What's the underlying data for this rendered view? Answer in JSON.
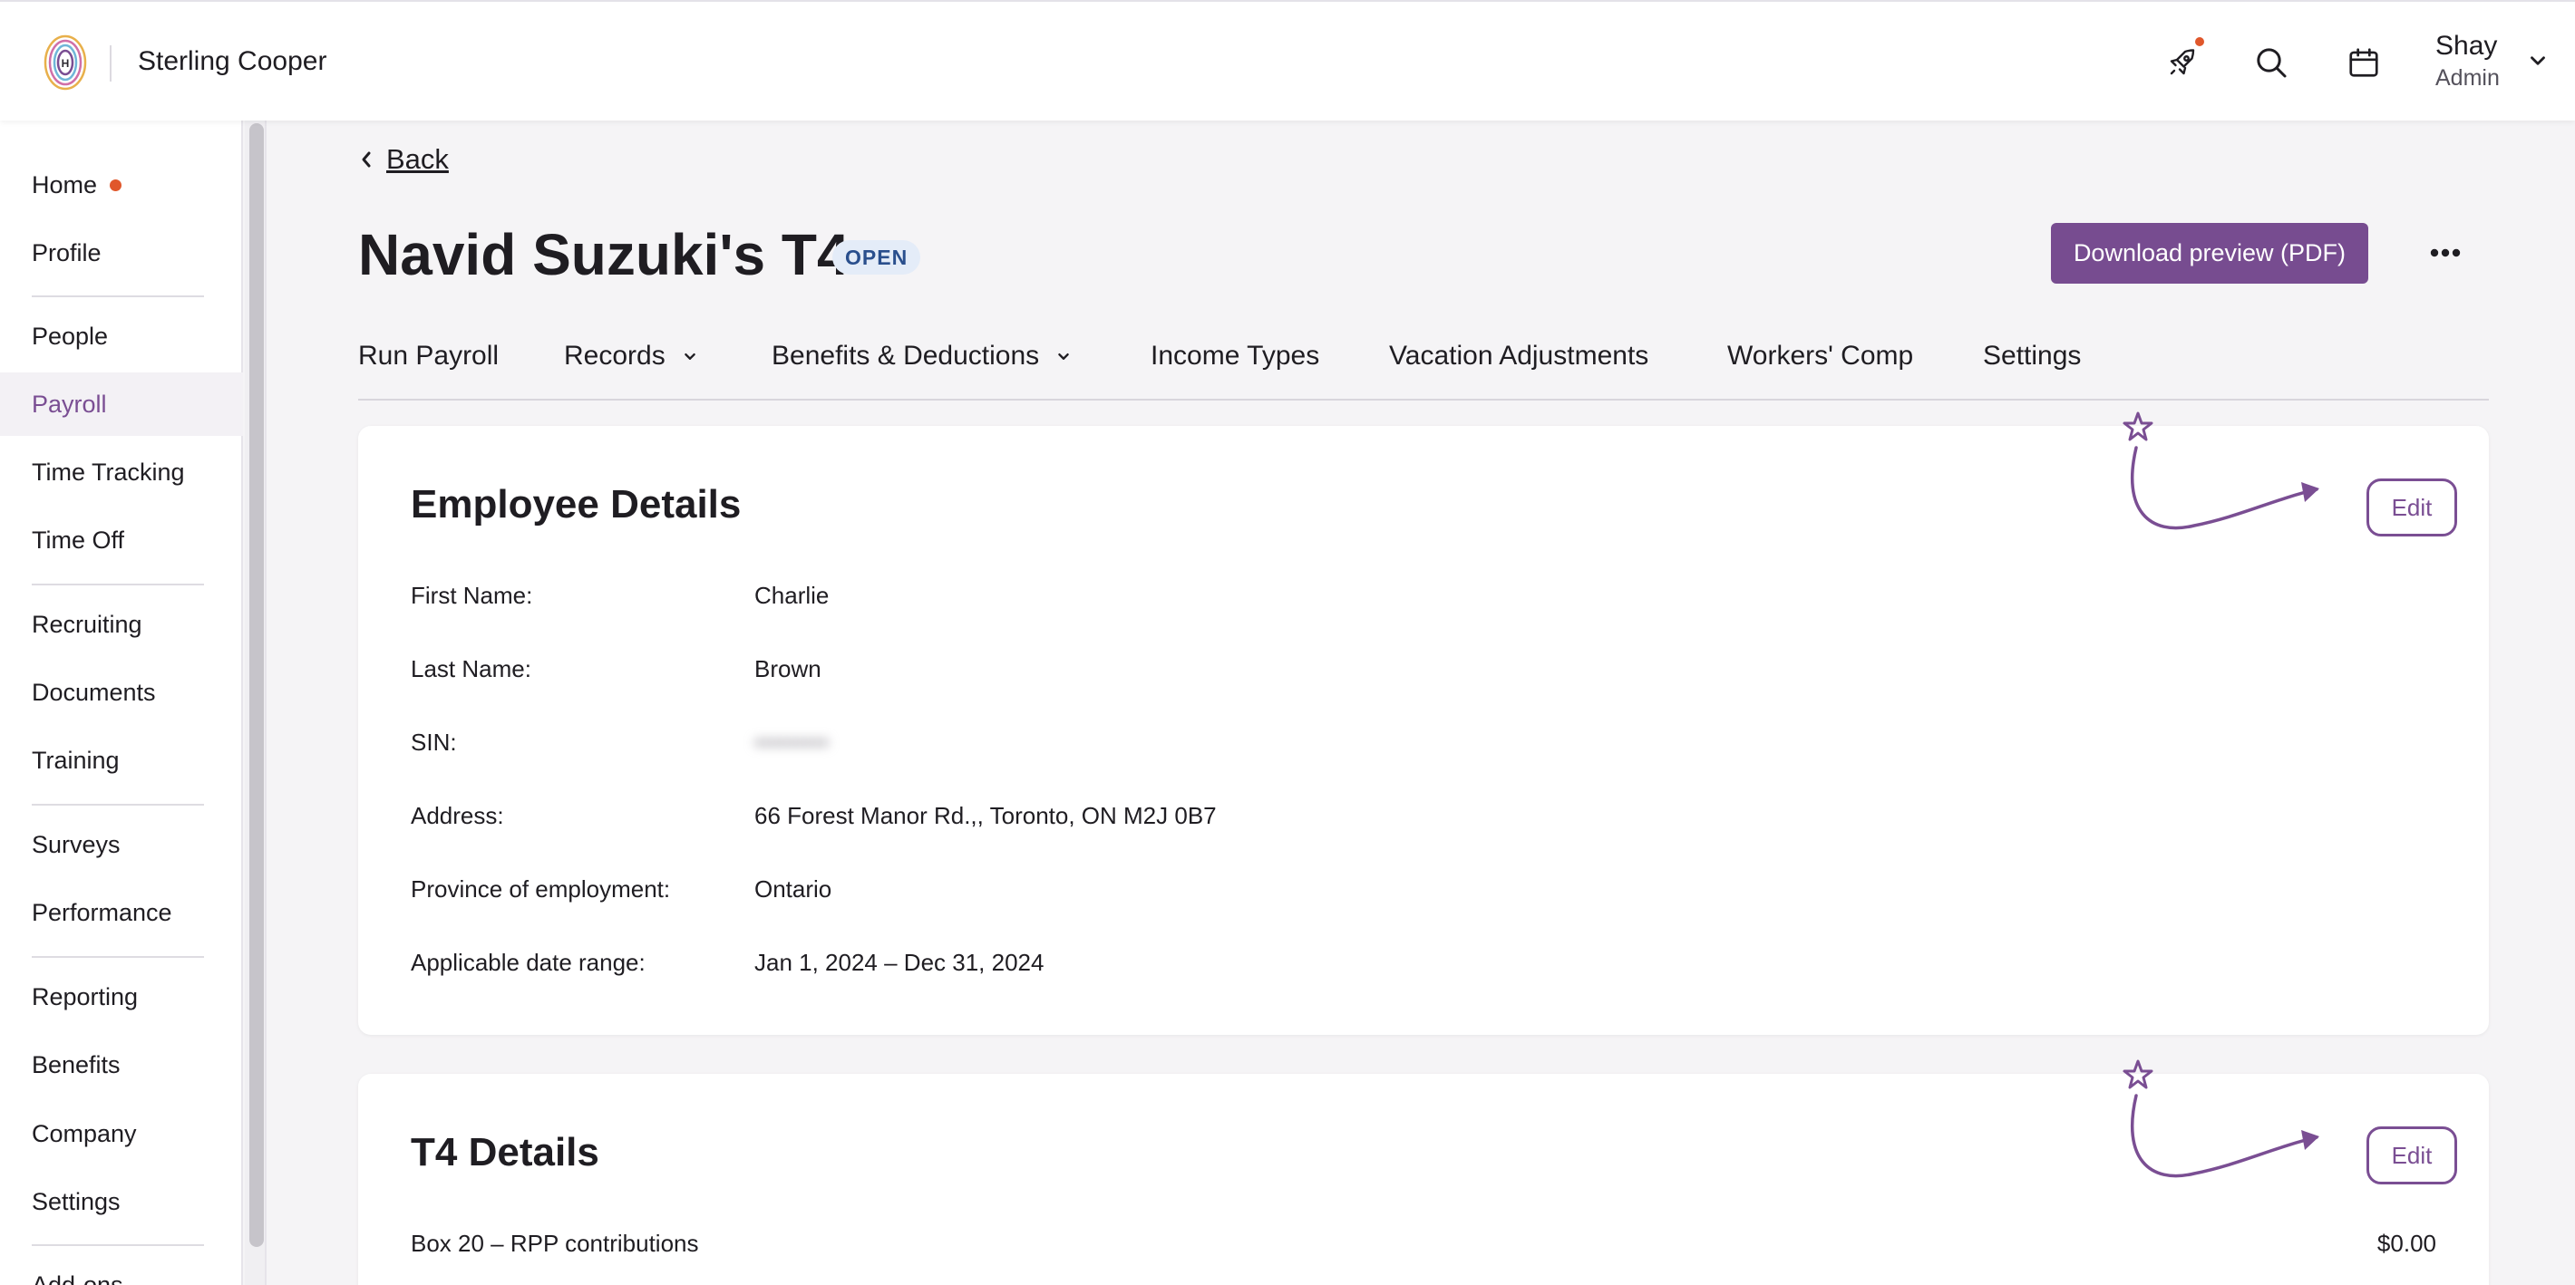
{
  "header": {
    "company_name": "Sterling Cooper",
    "user_name": "Shay",
    "user_role": "Admin",
    "icons": [
      "logo-icon",
      "rocket-icon",
      "search-icon",
      "calendar-icon",
      "chevron-down-icon"
    ]
  },
  "sidebar": {
    "items": [
      {
        "label": "Home"
      },
      {
        "label": "Profile"
      },
      {
        "label": "People"
      },
      {
        "label": "Payroll",
        "active": true
      },
      {
        "label": "Time Tracking"
      },
      {
        "label": "Time Off"
      },
      {
        "label": "Recruiting"
      },
      {
        "label": "Documents"
      },
      {
        "label": "Training"
      },
      {
        "label": "Surveys"
      },
      {
        "label": "Performance"
      },
      {
        "label": "Reporting"
      },
      {
        "label": "Benefits"
      },
      {
        "label": "Company"
      },
      {
        "label": "Settings"
      },
      {
        "label": "Add-ons"
      }
    ]
  },
  "page": {
    "back_label": "Back",
    "title": "Navid Suzuki's T4",
    "status_badge": "OPEN",
    "download_label": "Download preview (PDF)"
  },
  "tabs": [
    {
      "label": "Run Payroll"
    },
    {
      "label": "Records"
    },
    {
      "label": "Benefits & Deductions"
    },
    {
      "label": "Income Types"
    },
    {
      "label": "Vacation Adjustments"
    },
    {
      "label": "Workers' Comp"
    },
    {
      "label": "Settings"
    }
  ],
  "employee_details": {
    "title": "Employee Details",
    "edit_label": "Edit",
    "rows": [
      {
        "label": "First Name:",
        "value": "Charlie"
      },
      {
        "label": "Last Name:",
        "value": "Brown"
      },
      {
        "label": "SIN:",
        "value": "•••••••••"
      },
      {
        "label": "Address:",
        "value": "66 Forest Manor Rd.,, Toronto, ON M2J 0B7"
      },
      {
        "label": "Province of employment:",
        "value": "Ontario"
      },
      {
        "label": "Applicable date range:",
        "value": "Jan 1, 2024 – Dec 31, 2024"
      }
    ]
  },
  "t4_details": {
    "title": "T4 Details",
    "edit_label": "Edit",
    "rows": [
      {
        "label": "Box 20 – RPP contributions",
        "value": "$0.00"
      }
    ]
  },
  "colors": {
    "accent": "#774c90",
    "notification": "#e0572b",
    "badge_bg": "#e4ecf8",
    "badge_text": "#2a4f8d"
  }
}
